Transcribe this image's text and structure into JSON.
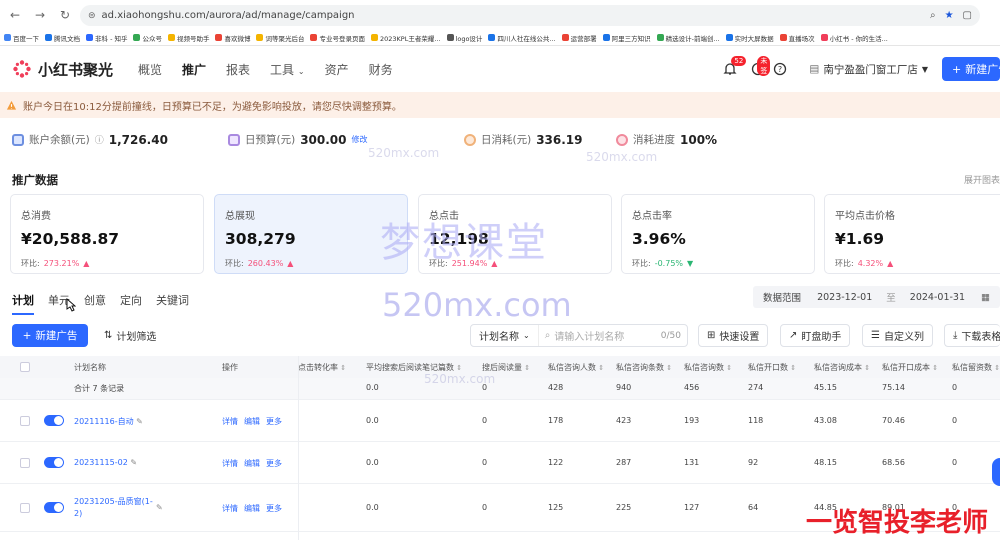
{
  "browser": {
    "url": "ad.xiaohongshu.com/aurora/ad/manage/campaign",
    "bookmarks": [
      "百度一下",
      "腾讯文档",
      "非科 - 知乎",
      "公众号",
      "视频号助手",
      "喜欢微博",
      "词等聚光后台",
      "专业号登录页面",
      "2023KPL王者荣耀...",
      "logo设计",
      "四川人社在线公共...",
      "运营部署",
      "阿里三方知识",
      "精选设计-前端创...",
      "实时大屏数据",
      "直播场次",
      "小红书 - 你的生活..."
    ],
    "colors": {
      "accent": "#2c68ff"
    }
  },
  "header": {
    "brand": "小红书聚光",
    "menu": [
      "概览",
      "推广",
      "报表",
      "工具",
      "资产",
      "财务"
    ],
    "active_menu": "推广",
    "bell_badge": "52",
    "notice_badge": "未签",
    "shop": "南宁盈盈门窗工厂店",
    "new_button": "新建广告"
  },
  "alert": {
    "text": "账户今日在10:12分提前撞线，日预算已不足，为避免影响投放，请您尽快调整预算。"
  },
  "balance": {
    "account_label": "账户余额(元)",
    "account_value": "1,726.40",
    "budget_label": "日预算(元)",
    "budget_value": "300.00",
    "budget_edit": "修改",
    "spent_label": "日消耗(元)",
    "spent_value": "336.19",
    "progress_label": "消耗进度",
    "progress_value": "100%"
  },
  "promo": {
    "title": "推广数据",
    "right_action": "展开图表",
    "cards": [
      {
        "label": "总消费",
        "value": "¥20,588.87",
        "cmp_label": "环比:",
        "cmp": "273.21%",
        "trend": "up"
      },
      {
        "label": "总展现",
        "value": "308,279",
        "cmp_label": "环比:",
        "cmp": "260.43%",
        "trend": "up"
      },
      {
        "label": "总点击",
        "value": "12,198",
        "cmp_label": "环比:",
        "cmp": "251.94%",
        "trend": "up"
      },
      {
        "label": "总点击率",
        "value": "3.96%",
        "cmp_label": "环比:",
        "cmp": "-0.75%",
        "trend": "down"
      },
      {
        "label": "平均点击价格",
        "value": "¥1.69",
        "cmp_label": "环比:",
        "cmp": "4.32%",
        "trend": "up"
      }
    ]
  },
  "tabs": [
    "计划",
    "单元",
    "创意",
    "定向",
    "关键词"
  ],
  "date_range": {
    "label": "数据范围",
    "start": "2023-12-01",
    "sep": "至",
    "end": "2024-01-31"
  },
  "toolbar": {
    "new_ad": "新建广告",
    "plan_filter": "计划筛选",
    "search_field": "计划名称",
    "search_placeholder": "请输入计划名称",
    "search_count": "0/50",
    "quick_settings": "快速设置",
    "review": "盯盘助手",
    "custom_columns": "自定义列",
    "download": "下载表格"
  },
  "table": {
    "headers": [
      "计划名称",
      "操作",
      "点击转化率",
      "平均搜索后阅读笔记篇数",
      "搜后阅读量",
      "私信咨询人数",
      "私信咨询条数",
      "私信咨询数",
      "私信开口数",
      "私信咨询成本",
      "私信开口成本",
      "私信留资数"
    ],
    "total_label": "合计 7 条记录",
    "total": [
      "",
      "0.0",
      "0",
      "428",
      "940",
      "456",
      "274",
      "45.15",
      "75.14",
      "0"
    ],
    "rows": [
      {
        "name": "20211116-自动",
        "ops": [
          "详情",
          "编辑",
          "更多"
        ],
        "cells": [
          "",
          "0.0",
          "0",
          "178",
          "423",
          "193",
          "118",
          "43.08",
          "70.46",
          "0"
        ]
      },
      {
        "name": "20231115-02",
        "ops": [
          "详情",
          "编辑",
          "更多"
        ],
        "cells": [
          "",
          "0.0",
          "0",
          "122",
          "287",
          "131",
          "92",
          "48.15",
          "68.56",
          "0"
        ]
      },
      {
        "name": "20231205-品质窗(1-2)",
        "ops": [
          "详情",
          "编辑",
          "更多"
        ],
        "cells": [
          "",
          "0.0",
          "0",
          "125",
          "225",
          "127",
          "64",
          "44.85",
          "89.01",
          "0"
        ]
      }
    ]
  },
  "overlay": {
    "watermark_small": "520mx.com",
    "watermark_big": "梦想课堂",
    "watermark_url": "520mx.com",
    "tagline": "一览智投李老师"
  }
}
